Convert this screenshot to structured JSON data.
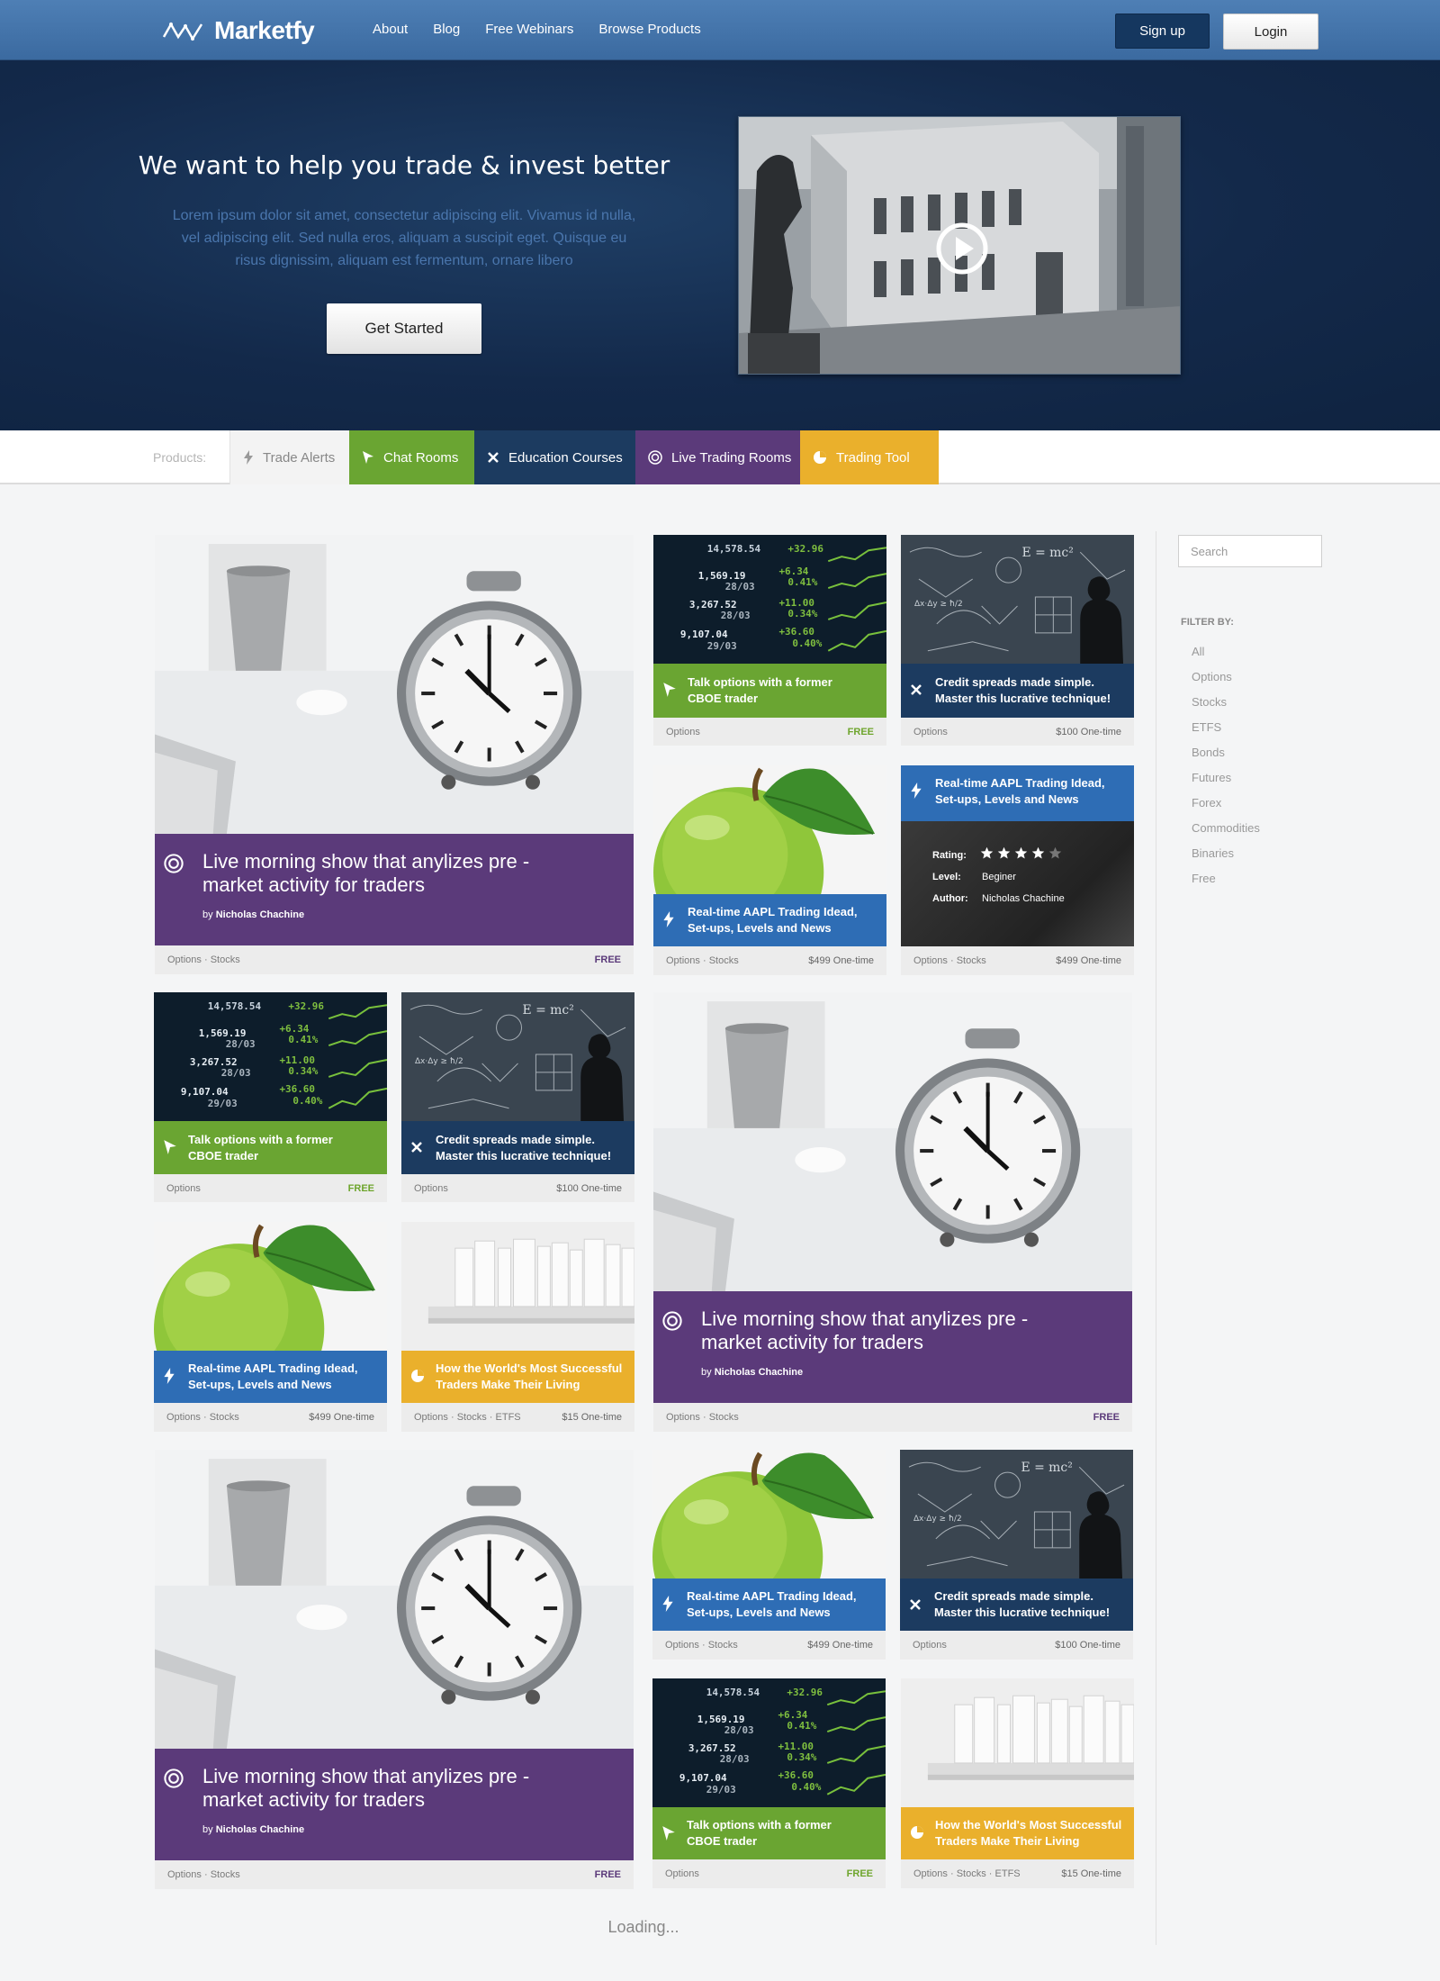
{
  "header": {
    "logo_text": "Marketfy",
    "nav": [
      "About",
      "Blog",
      "Free Webinars",
      "Browse Products"
    ],
    "signup_label": "Sign up",
    "login_label": "Login"
  },
  "hero": {
    "title": "We want to help you trade & invest better",
    "text": "Lorem ipsum dolor sit amet, consectetur adipiscing elit. Vivamus id nulla, vel adipiscing elit. Sed nulla eros, aliquam a suscipit eget. Quisque eu risus dignissim, aliquam est fermentum, ornare libero",
    "cta_label": "Get Started"
  },
  "products": {
    "label": "Products:",
    "tabs": [
      {
        "label": "Trade Alerts",
        "icon": "bolt-icon",
        "color": "#f3f3f3"
      },
      {
        "label": "Chat Rooms",
        "icon": "cursor-icon",
        "color": "#6aa532"
      },
      {
        "label": "Education Courses",
        "icon": "cross-tools-icon",
        "color": "#1c3b60"
      },
      {
        "label": "Live Trading Rooms",
        "icon": "target-icon",
        "color": "#5b3a7a"
      },
      {
        "label": "Trading Tool",
        "icon": "pie-icon",
        "color": "#eab02c"
      }
    ]
  },
  "cards": {
    "big_title": "Live morning show that anylizes pre - market activity for traders",
    "big_by_prefix": "by ",
    "big_author": "Nicholas Chachine",
    "talk_title": "Talk options with a former CBOE trader",
    "credit_title": "Credit spreads made simple. Master this lucrative technique!",
    "aapl_title": "Real-time AAPL Trading Idead, Set-ups, Levels and News",
    "world_title": "How the World's Most Successful Traders Make Their Living",
    "tag_options": "Options",
    "tag_stocks": "Stocks",
    "tag_etfs": "ETFS",
    "sep": "·",
    "price_free": "FREE",
    "price_100": "$100 One-time",
    "price_499": "$499 One-time",
    "price_15": "$15 One-time",
    "detail": {
      "rating_label": "Rating:",
      "rating_stars": 4,
      "rating_max": 5,
      "level_label": "Level:",
      "level_value": "Beginer",
      "author_label": "Author:",
      "author_value": "Nicholas Chachine"
    }
  },
  "sidebar": {
    "search_placeholder": "Search",
    "filter_heading": "FILTER BY:",
    "filters": [
      "All",
      "Options",
      "Stocks",
      "ETFS",
      "Bonds",
      "Futures",
      "Forex",
      "Commodities",
      "Binaries",
      "Free"
    ]
  },
  "loading_text": "Loading...",
  "colors": {
    "purple": "#5b3a7a",
    "green": "#6aa532",
    "navy": "#1c3b60",
    "blue": "#2e6db5",
    "yellow": "#eab02c",
    "header": "#3b6aa0"
  }
}
